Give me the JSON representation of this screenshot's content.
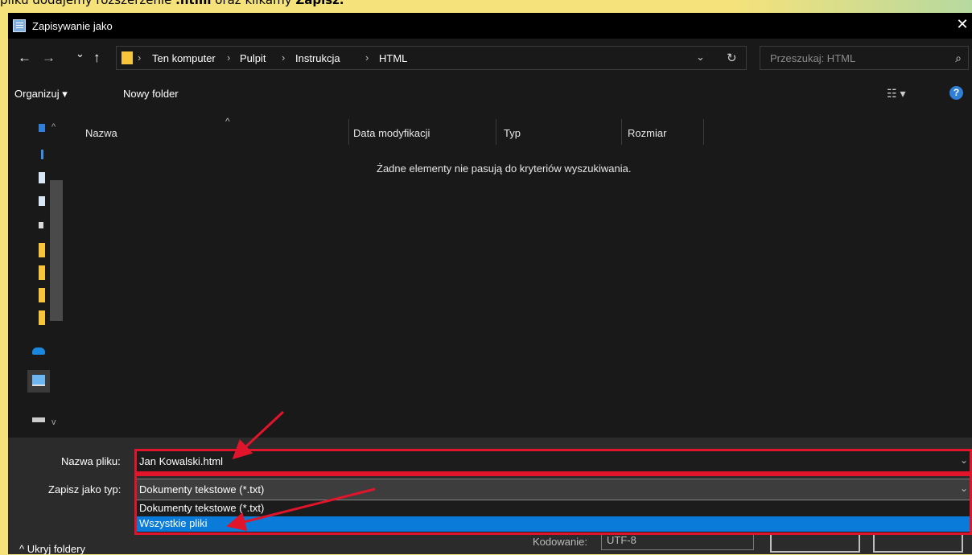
{
  "background_text": {
    "pre": "pliku dodajemy rozszerzenie ",
    "ext": ".html",
    "mid": " oraz klikamy ",
    "btn": "Zapisz."
  },
  "dialog": {
    "title": "Zapisywanie jako",
    "close_glyph": "✕"
  },
  "nav": {
    "back_glyph": "←",
    "forward_glyph": "→",
    "recent_glyph": "⌄",
    "up_glyph": "↑"
  },
  "breadcrumb": {
    "sep": "›",
    "items": [
      "Ten komputer",
      "Pulpit",
      "Instrukcja",
      "HTML"
    ],
    "dropdown_glyph": "⌄",
    "refresh_glyph": "↻"
  },
  "search": {
    "placeholder": "Przeszukaj: HTML",
    "icon_glyph": "⌕"
  },
  "toolbar": {
    "organize": "Organizuj ▾",
    "new_folder": "Nowy folder",
    "view_glyph": "☷ ▾",
    "help_glyph": "?"
  },
  "columns": {
    "name": "Nazwa",
    "modified": "Data modyfikacji",
    "type": "Typ",
    "size": "Rozmiar",
    "sort_glyph": "^"
  },
  "file_list": {
    "empty_message": "Żadne elementy nie pasują do kryteriów wyszukiwania."
  },
  "form": {
    "filename_label": "Nazwa pliku:",
    "filename_value": "Jan Kowalski.html",
    "type_label": "Zapisz jako typ:",
    "type_value": "Dokumenty tekstowe (*.txt)",
    "chevron": "⌄",
    "options": [
      "Dokumenty tekstowe (*.txt)",
      "Wszystkie pliki"
    ],
    "selected_option": "Wszystkie pliki",
    "encoding_label": "Kodowanie:",
    "encoding_value": "UTF-8"
  },
  "footer": {
    "hide_folders": "^  Ukryj foldery"
  },
  "colors": {
    "dialog_bg": "#191919",
    "accent": "#0a7bd8",
    "annotation_red": "#e0142a",
    "page_bg": "#f6e27a"
  }
}
